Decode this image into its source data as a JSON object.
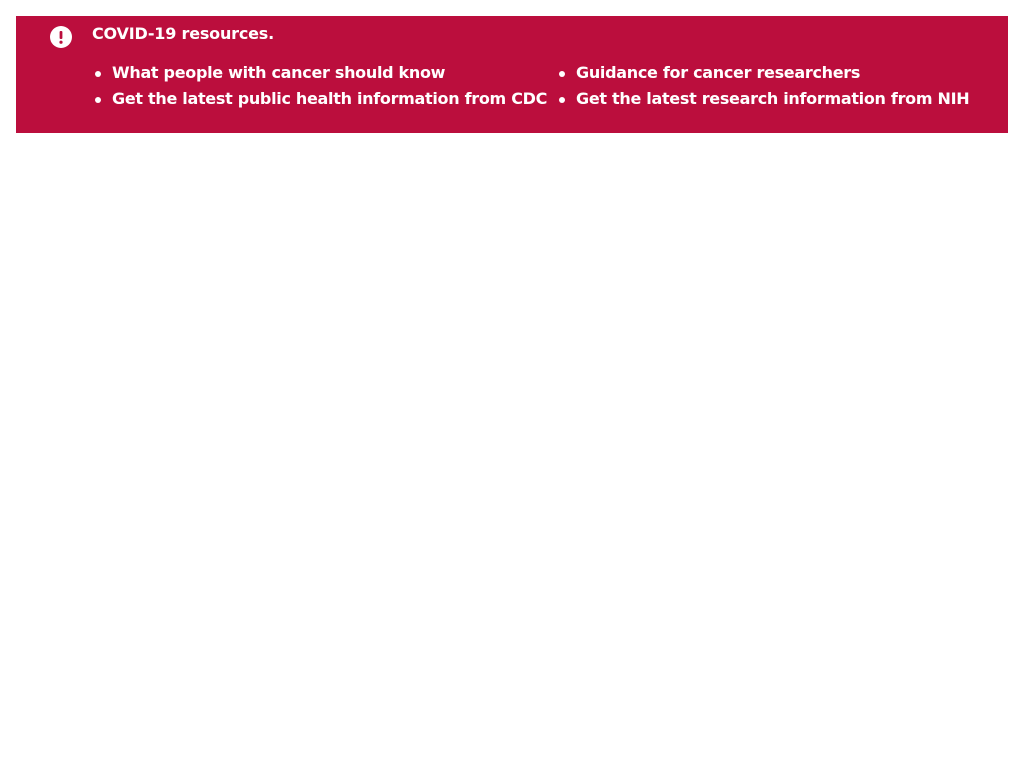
{
  "banner": {
    "icon": "exclamation-circle-icon",
    "title": "COVID-19 resources.",
    "background_color": "#bb0e3d",
    "text_color": "#ffffff",
    "left_links": [
      {
        "label": "What people with cancer should know"
      },
      {
        "label": "Get the latest public health information from CDC"
      }
    ],
    "right_links": [
      {
        "label": "Guidance for cancer researchers"
      },
      {
        "label": "Get the latest research information from NIH"
      }
    ]
  }
}
